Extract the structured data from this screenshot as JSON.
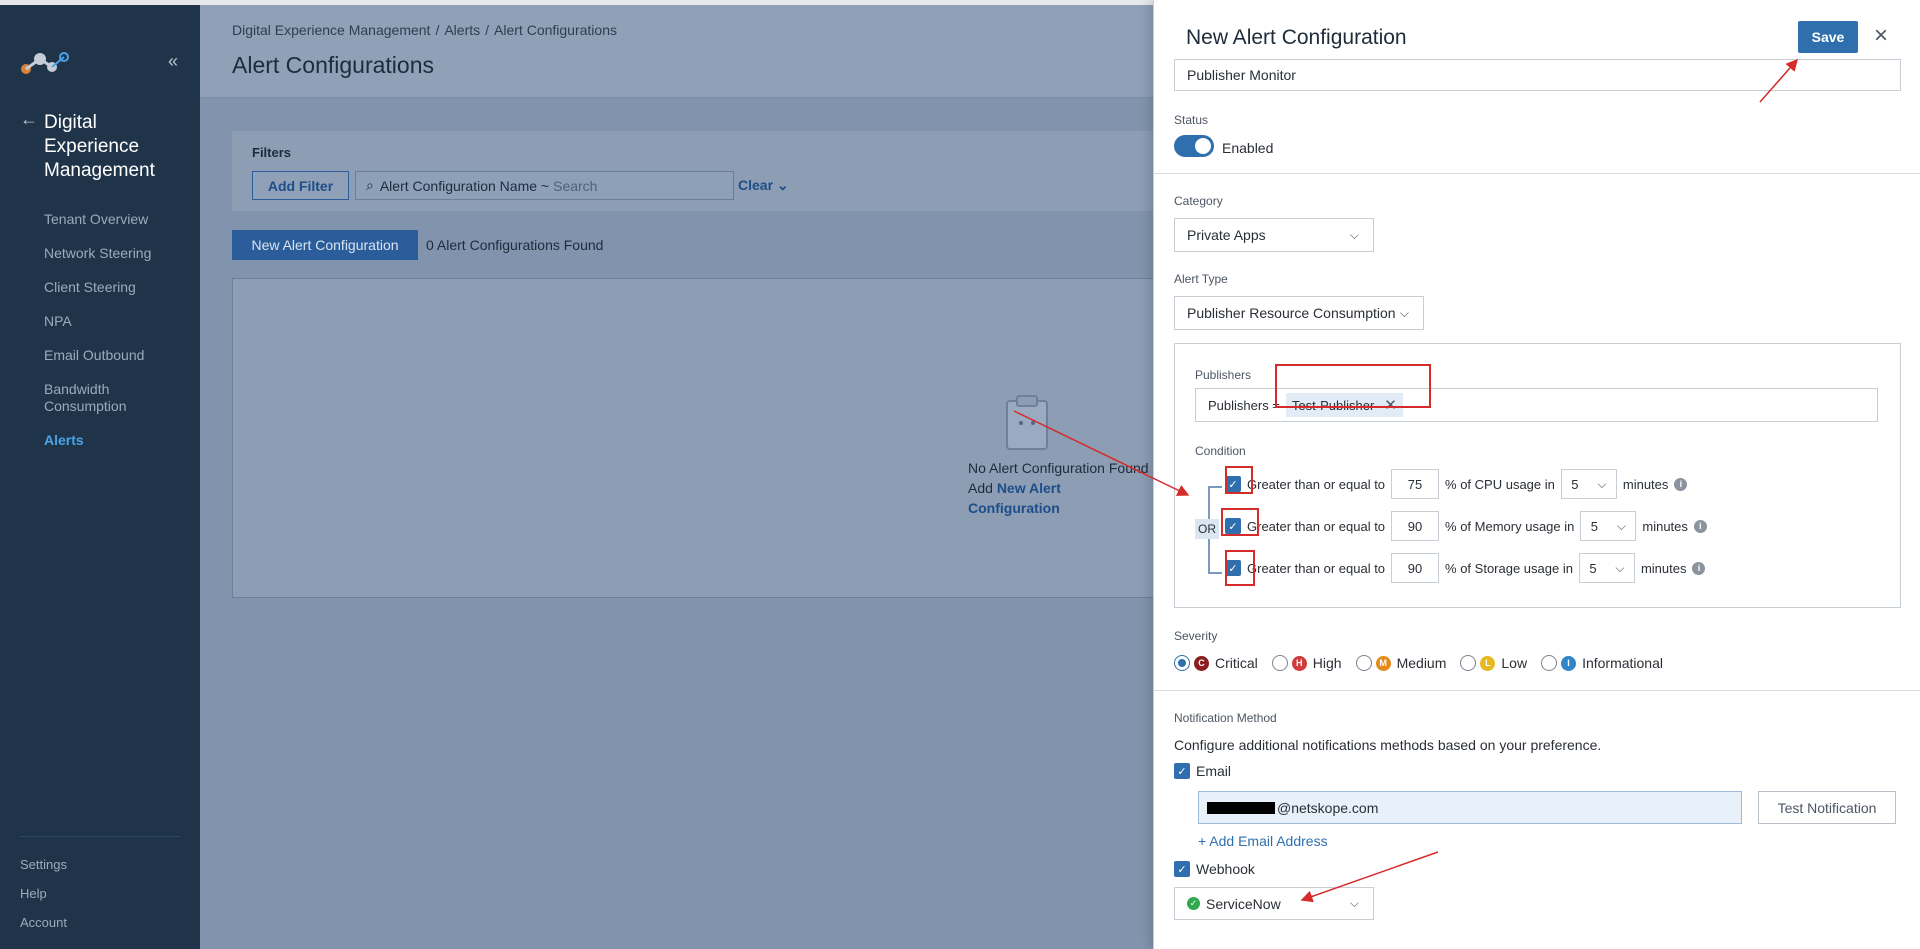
{
  "sidebar": {
    "section_title": "Digital Experience Management",
    "items": [
      {
        "label": "Tenant Overview"
      },
      {
        "label": "Network Steering"
      },
      {
        "label": "Client Steering"
      },
      {
        "label": "NPA"
      },
      {
        "label": "Email Outbound"
      },
      {
        "label": "Bandwidth Consumption"
      },
      {
        "label": "Alerts"
      }
    ],
    "bottom": [
      "Settings",
      "Help",
      "Account"
    ]
  },
  "main": {
    "breadcrumb": [
      "Digital Experience Management",
      "Alerts",
      "Alert Configurations"
    ],
    "title": "Alert Configurations",
    "filters_label": "Filters",
    "add_filter": "Add Filter",
    "search_field": "Alert Configuration Name ~",
    "search_placeholder": "Search",
    "clear": "Clear",
    "new_button": "New Alert Configuration",
    "found": "0 Alert Configurations Found",
    "empty_line1": "No Alert Configuration Found",
    "empty_add": "Add",
    "empty_link": "New Alert Configuration"
  },
  "drawer": {
    "title": "New Alert Configuration",
    "save": "Save",
    "name_value": "Publisher Monitor",
    "status_label": "Status",
    "status_value": "Enabled",
    "category_label": "Category",
    "category_value": "Private Apps",
    "alert_type_label": "Alert Type",
    "alert_type_value": "Publisher Resource Consumption",
    "publishers_label": "Publishers",
    "publishers_prefix": "Publishers =",
    "publisher_tag": "Test-Publisher",
    "condition_label": "Condition",
    "or_label": "OR",
    "conditions": [
      {
        "prefix": "Greater than or equal to",
        "value": "75",
        "metric": "% of CPU usage in",
        "minutes": "5",
        "suffix": "minutes"
      },
      {
        "prefix": "Greater than or equal to",
        "value": "90",
        "metric": "% of Memory usage in",
        "minutes": "5",
        "suffix": "minutes"
      },
      {
        "prefix": "Greater than or equal to",
        "value": "90",
        "metric": "% of Storage usage in",
        "minutes": "5",
        "suffix": "minutes"
      }
    ],
    "severity_label": "Severity",
    "severities": [
      {
        "badge": "C",
        "label": "Critical",
        "color": "#8b1e1e",
        "selected": true
      },
      {
        "badge": "H",
        "label": "High",
        "color": "#d13b3b",
        "selected": false
      },
      {
        "badge": "M",
        "label": "Medium",
        "color": "#e28a1a",
        "selected": false
      },
      {
        "badge": "L",
        "label": "Low",
        "color": "#e8b820",
        "selected": false
      },
      {
        "badge": "I",
        "label": "Informational",
        "color": "#2f86c8",
        "selected": false
      }
    ],
    "notification_label": "Notification Method",
    "notification_desc": "Configure additional notifications methods based on your preference.",
    "email_label": "Email",
    "email_value": "@netskope.com",
    "test_notification": "Test Notification",
    "add_email": "Add Email Address",
    "webhook_label": "Webhook",
    "webhook_value": "ServiceNow"
  }
}
